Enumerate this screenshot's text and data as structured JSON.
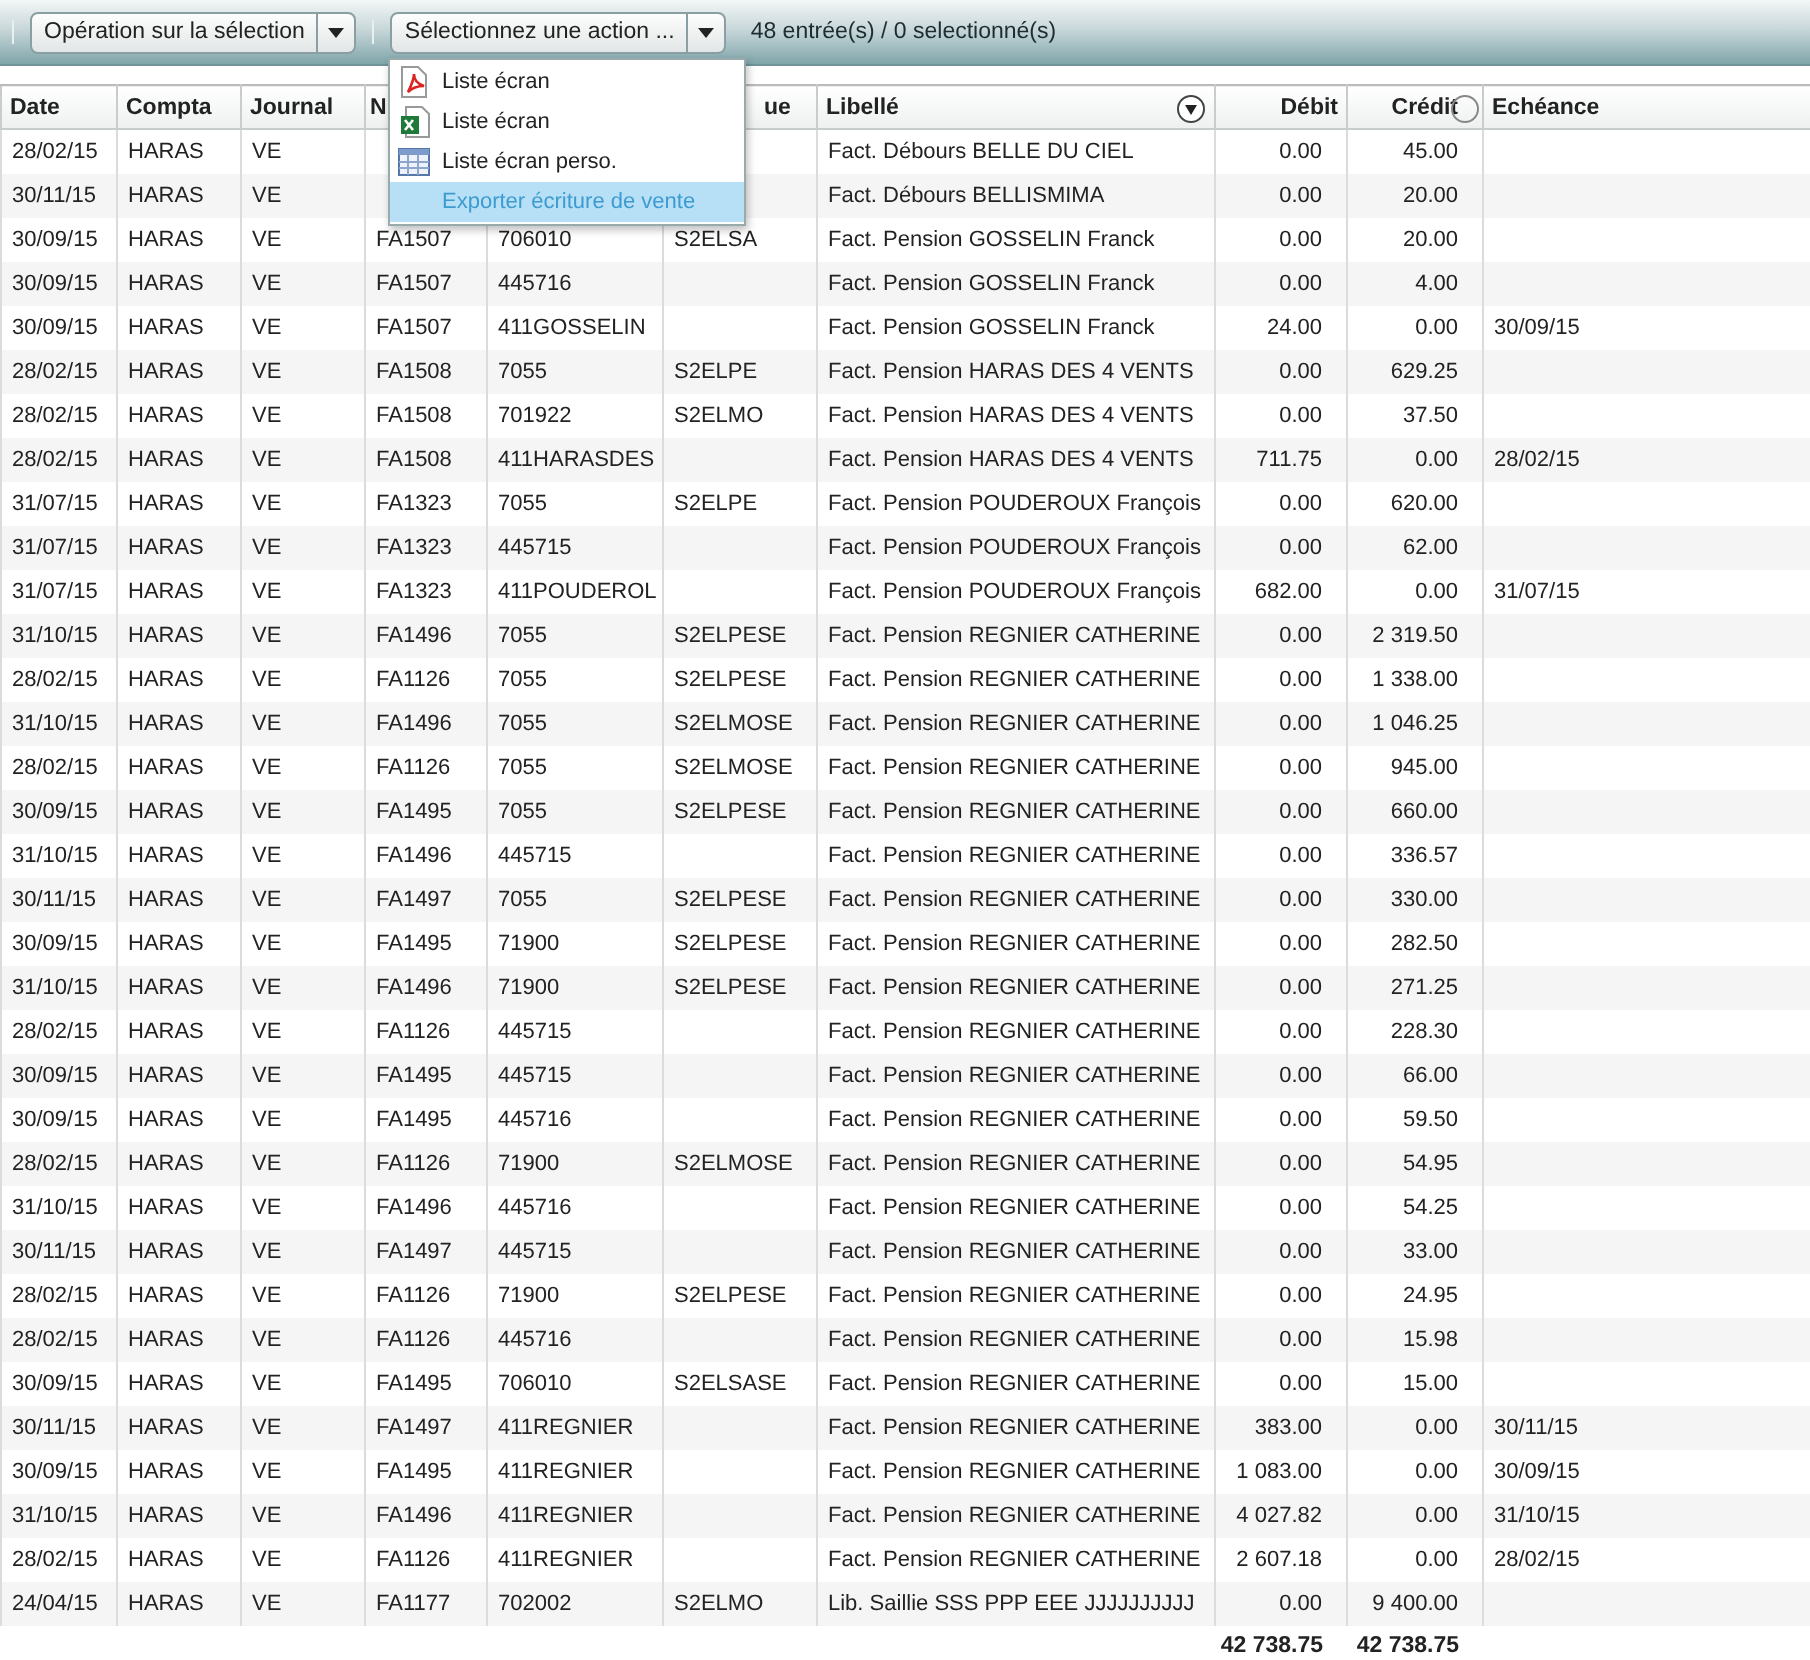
{
  "toolbar": {
    "operation_button": "Opération sur la sélection",
    "action_button": "Sélectionnez une action ...",
    "count": "48 entrée(s) / 0 selectionné(s)"
  },
  "action_menu": [
    {
      "label": "Liste écran",
      "kind": "pdf",
      "selected": false
    },
    {
      "label": "Liste écran",
      "kind": "excel",
      "selected": false
    },
    {
      "label": "Liste écran perso.",
      "kind": "table",
      "selected": false
    },
    {
      "label": "Exporter écriture de vente",
      "kind": "none",
      "selected": true
    }
  ],
  "table": {
    "columns": {
      "date": "Date",
      "compta": "Compta",
      "journal": "Journal",
      "column_4": "N",
      "column_6": "ue",
      "libelle": "Libellé",
      "debit": "Débit",
      "credit": "Crédit",
      "echeance": "Echéance"
    },
    "rows": [
      {
        "date": "28/02/15",
        "compta": "HARAS",
        "journal": "VE",
        "libelle": "Fact. Débours BELLE DU CIEL",
        "debit": "0.00",
        "credit": "45.00"
      },
      {
        "date": "30/11/15",
        "compta": "HARAS",
        "journal": "VE",
        "libelle": "Fact. Débours BELLISMIMA",
        "debit": "0.00",
        "credit": "20.00"
      },
      {
        "date": "30/09/15",
        "compta": "HARAS",
        "journal": "VE",
        "column_4": "FA1507",
        "column_5": "706010",
        "column_6": "S2ELSA",
        "libelle": "Fact. Pension GOSSELIN Franck",
        "debit": "0.00",
        "credit": "20.00"
      },
      {
        "date": "30/09/15",
        "compta": "HARAS",
        "journal": "VE",
        "column_4": "FA1507",
        "column_5": "445716",
        "libelle": "Fact. Pension GOSSELIN Franck",
        "debit": "0.00",
        "credit": "4.00"
      },
      {
        "date": "30/09/15",
        "compta": "HARAS",
        "journal": "VE",
        "column_4": "FA1507",
        "column_5": "411GOSSELIN",
        "libelle": "Fact. Pension GOSSELIN Franck",
        "debit": "24.00",
        "credit": "0.00",
        "echeance": "30/09/15"
      },
      {
        "date": "28/02/15",
        "compta": "HARAS",
        "journal": "VE",
        "column_4": "FA1508",
        "column_5": "7055",
        "column_6": "S2ELPE",
        "libelle": "Fact. Pension HARAS DES 4 VENTS",
        "debit": "0.00",
        "credit": "629.25"
      },
      {
        "date": "28/02/15",
        "compta": "HARAS",
        "journal": "VE",
        "column_4": "FA1508",
        "column_5": "701922",
        "column_6": "S2ELMO",
        "libelle": "Fact. Pension HARAS DES 4 VENTS",
        "debit": "0.00",
        "credit": "37.50"
      },
      {
        "date": "28/02/15",
        "compta": "HARAS",
        "journal": "VE",
        "column_4": "FA1508",
        "column_5": "411HARASDES",
        "libelle": "Fact. Pension HARAS DES 4 VENTS",
        "debit": "711.75",
        "credit": "0.00",
        "echeance": "28/02/15"
      },
      {
        "date": "31/07/15",
        "compta": "HARAS",
        "journal": "VE",
        "column_4": "FA1323",
        "column_5": "7055",
        "column_6": "S2ELPE",
        "libelle": "Fact. Pension POUDEROUX François",
        "debit": "0.00",
        "credit": "620.00"
      },
      {
        "date": "31/07/15",
        "compta": "HARAS",
        "journal": "VE",
        "column_4": "FA1323",
        "column_5": "445715",
        "libelle": "Fact. Pension POUDEROUX François",
        "debit": "0.00",
        "credit": "62.00"
      },
      {
        "date": "31/07/15",
        "compta": "HARAS",
        "journal": "VE",
        "column_4": "FA1323",
        "column_5": "411POUDEROL",
        "libelle": "Fact. Pension POUDEROUX François",
        "debit": "682.00",
        "credit": "0.00",
        "echeance": "31/07/15"
      },
      {
        "date": "31/10/15",
        "compta": "HARAS",
        "journal": "VE",
        "column_4": "FA1496",
        "column_5": "7055",
        "column_6": "S2ELPESE",
        "libelle": "Fact. Pension REGNIER CATHERINE",
        "debit": "0.00",
        "credit": "2 319.50"
      },
      {
        "date": "28/02/15",
        "compta": "HARAS",
        "journal": "VE",
        "column_4": "FA1126",
        "column_5": "7055",
        "column_6": "S2ELPESE",
        "libelle": "Fact. Pension REGNIER CATHERINE",
        "debit": "0.00",
        "credit": "1 338.00"
      },
      {
        "date": "31/10/15",
        "compta": "HARAS",
        "journal": "VE",
        "column_4": "FA1496",
        "column_5": "7055",
        "column_6": "S2ELMOSE",
        "libelle": "Fact. Pension REGNIER CATHERINE",
        "debit": "0.00",
        "credit": "1 046.25"
      },
      {
        "date": "28/02/15",
        "compta": "HARAS",
        "journal": "VE",
        "column_4": "FA1126",
        "column_5": "7055",
        "column_6": "S2ELMOSE",
        "libelle": "Fact. Pension REGNIER CATHERINE",
        "debit": "0.00",
        "credit": "945.00"
      },
      {
        "date": "30/09/15",
        "compta": "HARAS",
        "journal": "VE",
        "column_4": "FA1495",
        "column_5": "7055",
        "column_6": "S2ELPESE",
        "libelle": "Fact. Pension REGNIER CATHERINE",
        "debit": "0.00",
        "credit": "660.00"
      },
      {
        "date": "31/10/15",
        "compta": "HARAS",
        "journal": "VE",
        "column_4": "FA1496",
        "column_5": "445715",
        "libelle": "Fact. Pension REGNIER CATHERINE",
        "debit": "0.00",
        "credit": "336.57"
      },
      {
        "date": "30/11/15",
        "compta": "HARAS",
        "journal": "VE",
        "column_4": "FA1497",
        "column_5": "7055",
        "column_6": "S2ELPESE",
        "libelle": "Fact. Pension REGNIER CATHERINE",
        "debit": "0.00",
        "credit": "330.00"
      },
      {
        "date": "30/09/15",
        "compta": "HARAS",
        "journal": "VE",
        "column_4": "FA1495",
        "column_5": "71900",
        "column_6": "S2ELPESE",
        "libelle": "Fact. Pension REGNIER CATHERINE",
        "debit": "0.00",
        "credit": "282.50"
      },
      {
        "date": "31/10/15",
        "compta": "HARAS",
        "journal": "VE",
        "column_4": "FA1496",
        "column_5": "71900",
        "column_6": "S2ELPESE",
        "libelle": "Fact. Pension REGNIER CATHERINE",
        "debit": "0.00",
        "credit": "271.25"
      },
      {
        "date": "28/02/15",
        "compta": "HARAS",
        "journal": "VE",
        "column_4": "FA1126",
        "column_5": "445715",
        "libelle": "Fact. Pension REGNIER CATHERINE",
        "debit": "0.00",
        "credit": "228.30"
      },
      {
        "date": "30/09/15",
        "compta": "HARAS",
        "journal": "VE",
        "column_4": "FA1495",
        "column_5": "445715",
        "libelle": "Fact. Pension REGNIER CATHERINE",
        "debit": "0.00",
        "credit": "66.00"
      },
      {
        "date": "30/09/15",
        "compta": "HARAS",
        "journal": "VE",
        "column_4": "FA1495",
        "column_5": "445716",
        "libelle": "Fact. Pension REGNIER CATHERINE",
        "debit": "0.00",
        "credit": "59.50"
      },
      {
        "date": "28/02/15",
        "compta": "HARAS",
        "journal": "VE",
        "column_4": "FA1126",
        "column_5": "71900",
        "column_6": "S2ELMOSE",
        "libelle": "Fact. Pension REGNIER CATHERINE",
        "debit": "0.00",
        "credit": "54.95"
      },
      {
        "date": "31/10/15",
        "compta": "HARAS",
        "journal": "VE",
        "column_4": "FA1496",
        "column_5": "445716",
        "libelle": "Fact. Pension REGNIER CATHERINE",
        "debit": "0.00",
        "credit": "54.25"
      },
      {
        "date": "30/11/15",
        "compta": "HARAS",
        "journal": "VE",
        "column_4": "FA1497",
        "column_5": "445715",
        "libelle": "Fact. Pension REGNIER CATHERINE",
        "debit": "0.00",
        "credit": "33.00"
      },
      {
        "date": "28/02/15",
        "compta": "HARAS",
        "journal": "VE",
        "column_4": "FA1126",
        "column_5": "71900",
        "column_6": "S2ELPESE",
        "libelle": "Fact. Pension REGNIER CATHERINE",
        "debit": "0.00",
        "credit": "24.95"
      },
      {
        "date": "28/02/15",
        "compta": "HARAS",
        "journal": "VE",
        "column_4": "FA1126",
        "column_5": "445716",
        "libelle": "Fact. Pension REGNIER CATHERINE",
        "debit": "0.00",
        "credit": "15.98"
      },
      {
        "date": "30/09/15",
        "compta": "HARAS",
        "journal": "VE",
        "column_4": "FA1495",
        "column_5": "706010",
        "column_6": "S2ELSASE",
        "libelle": "Fact. Pension REGNIER CATHERINE",
        "debit": "0.00",
        "credit": "15.00"
      },
      {
        "date": "30/11/15",
        "compta": "HARAS",
        "journal": "VE",
        "column_4": "FA1497",
        "column_5": "411REGNIER",
        "libelle": "Fact. Pension REGNIER CATHERINE",
        "debit": "383.00",
        "credit": "0.00",
        "echeance": "30/11/15"
      },
      {
        "date": "30/09/15",
        "compta": "HARAS",
        "journal": "VE",
        "column_4": "FA1495",
        "column_5": "411REGNIER",
        "libelle": "Fact. Pension REGNIER CATHERINE",
        "debit": "1 083.00",
        "credit": "0.00",
        "echeance": "30/09/15"
      },
      {
        "date": "31/10/15",
        "compta": "HARAS",
        "journal": "VE",
        "column_4": "FA1496",
        "column_5": "411REGNIER",
        "libelle": "Fact. Pension REGNIER CATHERINE",
        "debit": "4 027.82",
        "credit": "0.00",
        "echeance": "31/10/15"
      },
      {
        "date": "28/02/15",
        "compta": "HARAS",
        "journal": "VE",
        "column_4": "FA1126",
        "column_5": "411REGNIER",
        "libelle": "Fact. Pension REGNIER CATHERINE",
        "debit": "2 607.18",
        "credit": "0.00",
        "echeance": "28/02/15"
      },
      {
        "date": "24/04/15",
        "compta": "HARAS",
        "journal": "VE",
        "column_4": "FA1177",
        "column_5": "702002",
        "column_6": "S2ELMO",
        "libelle": "Lib. Saillie SSS PPP EEE JJJJJJJJJJ",
        "debit": "0.00",
        "credit": "9 400.00"
      }
    ],
    "totals": {
      "debit": "42 738.75",
      "credit": "42 738.75"
    }
  }
}
